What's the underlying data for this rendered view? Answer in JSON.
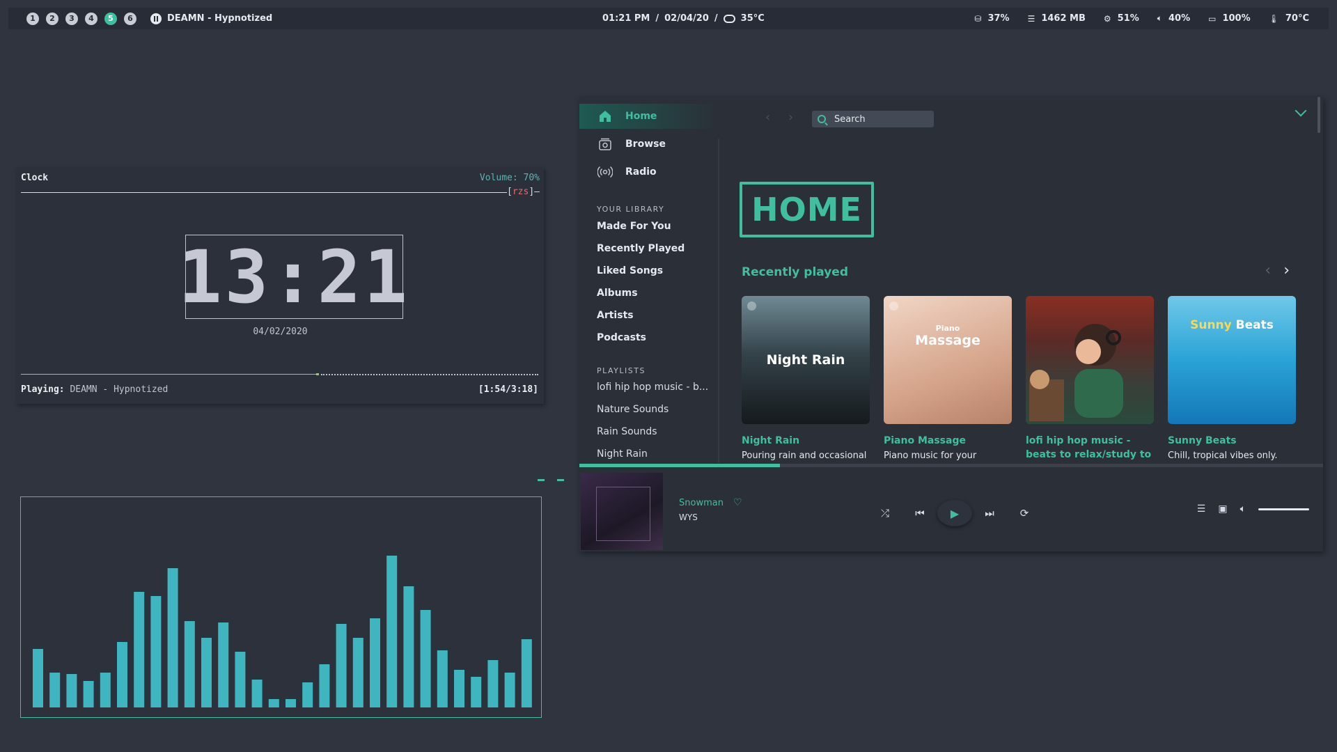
{
  "topbar": {
    "workspaces": [
      "1",
      "2",
      "3",
      "4",
      "5",
      "6"
    ],
    "active_workspace": "5",
    "now_playing": "DEAMN - Hypnotized",
    "time": "01:21 PM",
    "sep1": "/",
    "date": "02/04/20",
    "sep2": "/",
    "weather": "35°C",
    "disk": "37%",
    "memory": "1462 MB",
    "cpu": "51%",
    "volume": "40%",
    "battery": "100%",
    "temp": "70°C"
  },
  "clock": {
    "title": "Clock",
    "volume": "Volume: 70%",
    "tag_open": "[",
    "tag": "rzs",
    "tag_close": "]–",
    "big_time": "13:21",
    "date": "04/02/2020",
    "playing_label": "Playing:",
    "playing_track": "DEAMN - Hypnotized",
    "position": "[1:54/3:18]",
    "progress": 0.57
  },
  "visualizer": {
    "levels": [
      0.42,
      0.25,
      0.24,
      0.19,
      0.25,
      0.47,
      0.83,
      0.8,
      1.0,
      0.62,
      0.5,
      0.61,
      0.4,
      0.2,
      0.06,
      0.06,
      0.18,
      0.31,
      0.6,
      0.5,
      0.64,
      1.09,
      0.87,
      0.7,
      0.41,
      0.27,
      0.22,
      0.34,
      0.25,
      0.49
    ],
    "color": "#3fb6bf"
  },
  "spotify": {
    "nav": [
      {
        "label": "Home",
        "icon": "home-icon"
      },
      {
        "label": "Browse",
        "icon": "browse-icon"
      },
      {
        "label": "Radio",
        "icon": "radio-icon"
      }
    ],
    "library_title": "YOUR LIBRARY",
    "library": [
      "Made For You",
      "Recently Played",
      "Liked Songs",
      "Albums",
      "Artists",
      "Podcasts"
    ],
    "playlists_title": "PLAYLISTS",
    "playlists": [
      "lofi hip hop music - b...",
      "Nature Sounds",
      "Rain Sounds",
      "Night Rain"
    ],
    "search_placeholder": "Search",
    "home_heading": "HOME",
    "recently_played": "Recently played",
    "cards": [
      {
        "name": "Night Rain",
        "desc": "Pouring rain and occasional",
        "art_text": "Night Rain"
      },
      {
        "name": "Piano Massage",
        "desc": "Piano music for your",
        "art_small": "Piano",
        "art_text": "Massage"
      },
      {
        "name": "lofi hip hop music - beats to relax/study to",
        "desc": ""
      },
      {
        "name": "Sunny Beats",
        "desc": "Chill, tropical vibes only.",
        "art_text_a": "Sunny",
        "art_text_b": "Beats"
      }
    ],
    "player": {
      "track": "Snowman",
      "artist": "WYS",
      "progress": 0.27,
      "volume": 1.0
    },
    "accent": "#3fbfa0"
  }
}
